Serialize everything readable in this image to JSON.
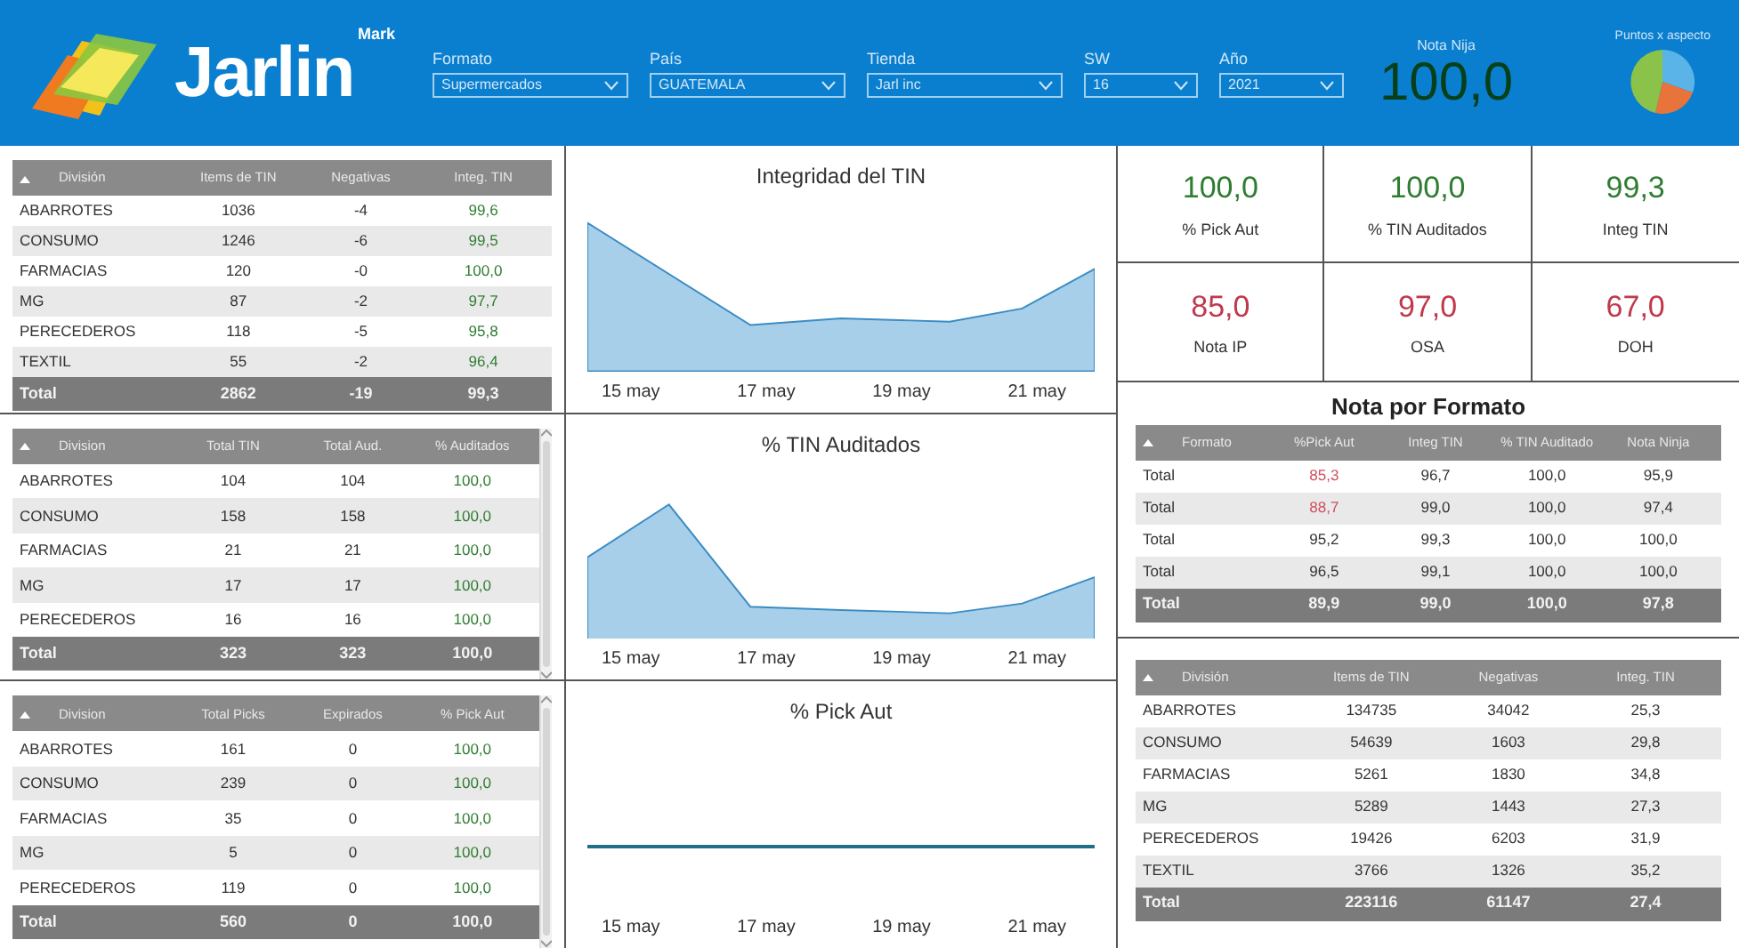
{
  "header": {
    "logo": {
      "word": "Jarlin",
      "badge": "Mark"
    },
    "filters": [
      {
        "label": "Formato",
        "value": "Supermercados"
      },
      {
        "label": "País",
        "value": "GUATEMALA"
      },
      {
        "label": "Tienda",
        "value": "Jarl inc"
      },
      {
        "label": "SW",
        "value": "16"
      },
      {
        "label": "Año",
        "value": "2021"
      }
    ],
    "score": {
      "label": "Nota Nija",
      "value": "100,0"
    },
    "pie": {
      "title": "Puntos x aspecto"
    }
  },
  "left_tables": [
    {
      "columns": [
        {
          "label": "División"
        },
        {
          "label": "Items de TIN"
        },
        {
          "label": "Negativas"
        },
        {
          "label": "Integ. TIN",
          "green": true
        }
      ],
      "rows": [
        [
          "ABARROTES",
          "1036",
          "-4",
          "99,6"
        ],
        [
          "CONSUMO",
          "1246",
          "-6",
          "99,5"
        ],
        [
          "FARMACIAS",
          "120",
          "-0",
          "100,0"
        ],
        [
          "MG",
          "87",
          "-2",
          "97,7"
        ],
        [
          "PERECEDEROS",
          "118",
          "-5",
          "95,8"
        ],
        [
          "TEXTIL",
          "55",
          "-2",
          "96,4"
        ]
      ],
      "total": [
        "Total",
        "2862",
        "-19",
        "99,3"
      ]
    },
    {
      "columns": [
        {
          "label": "Division"
        },
        {
          "label": "Total TIN"
        },
        {
          "label": "Total Aud."
        },
        {
          "label": "% Auditados",
          "green": true
        }
      ],
      "scrollbar": true,
      "rows": [
        [
          "ABARROTES",
          "104",
          "104",
          "100,0"
        ],
        [
          "CONSUMO",
          "158",
          "158",
          "100,0"
        ],
        [
          "FARMACIAS",
          "21",
          "21",
          "100,0"
        ],
        [
          "MG",
          "17",
          "17",
          "100,0"
        ],
        [
          "PERECEDEROS",
          "16",
          "16",
          "100,0"
        ]
      ],
      "total": [
        "Total",
        "323",
        "323",
        "100,0"
      ]
    },
    {
      "columns": [
        {
          "label": "Division"
        },
        {
          "label": "Total Picks"
        },
        {
          "label": "Expirados"
        },
        {
          "label": "% Pick Aut",
          "green": true
        }
      ],
      "scrollbar": true,
      "rows": [
        [
          "ABARROTES",
          "161",
          "0",
          "100,0"
        ],
        [
          "CONSUMO",
          "239",
          "0",
          "100,0"
        ],
        [
          "FARMACIAS",
          "35",
          "0",
          "100,0"
        ],
        [
          "MG",
          "5",
          "0",
          "100,0"
        ],
        [
          "PERECEDEROS",
          "119",
          "0",
          "100,0"
        ]
      ],
      "total": [
        "Total",
        "560",
        "0",
        "100,0"
      ]
    }
  ],
  "charts": [
    {
      "title": "Integridad del TIN",
      "kind": "area",
      "x_labels": [
        "15 may",
        "17 may",
        "19 may",
        "21 may"
      ]
    },
    {
      "title": "% TIN Auditados",
      "kind": "area",
      "x_labels": [
        "15 may",
        "17 may",
        "19 may",
        "21 may"
      ]
    },
    {
      "title": "% Pick Aut",
      "kind": "line",
      "x_labels": [
        "15 may",
        "17 may",
        "19 may",
        "21 may"
      ]
    }
  ],
  "kpis": [
    {
      "value": "100,0",
      "label": "% Pick Aut",
      "alert": false
    },
    {
      "value": "100,0",
      "label": "% TIN Auditados",
      "alert": false
    },
    {
      "value": "99,3",
      "label": "Integ TIN",
      "alert": false
    },
    {
      "value": "85,0",
      "label": "Nota IP",
      "alert": true
    },
    {
      "value": "97,0",
      "label": "OSA",
      "alert": true
    },
    {
      "value": "67,0",
      "label": "DOH",
      "alert": true
    }
  ],
  "format_table": {
    "title": "Nota por Formato",
    "columns": [
      {
        "label": "Formato"
      },
      {
        "label": "%Pick Aut"
      },
      {
        "label": "Integ TIN"
      },
      {
        "label": "% TIN Auditado"
      },
      {
        "label": "Nota Ninja"
      }
    ],
    "rows": [
      {
        "cells": [
          "Total",
          "85,3",
          "96,7",
          "100,0",
          "95,9"
        ],
        "low": [
          false,
          true,
          false,
          false,
          false
        ]
      },
      {
        "cells": [
          "Total",
          "88,7",
          "99,0",
          "100,0",
          "97,4"
        ],
        "low": [
          false,
          true,
          false,
          false,
          false
        ]
      },
      {
        "cells": [
          "Total",
          "95,2",
          "99,3",
          "100,0",
          "100,0"
        ],
        "low": [
          false,
          false,
          false,
          false,
          false
        ]
      },
      {
        "cells": [
          "Total",
          "96,5",
          "99,1",
          "100,0",
          "100,0"
        ],
        "low": [
          false,
          false,
          false,
          false,
          false
        ]
      }
    ],
    "total": [
      "Total",
      "89,9",
      "99,0",
      "100,0",
      "97,8"
    ]
  },
  "division_table": {
    "columns": [
      {
        "label": "División"
      },
      {
        "label": "Items de TIN"
      },
      {
        "label": "Negativas"
      },
      {
        "label": "Integ. TIN"
      }
    ],
    "rows": [
      [
        "ABARROTES",
        "134735",
        "34042",
        "25,3"
      ],
      [
        "CONSUMO",
        "54639",
        "1603",
        "29,8"
      ],
      [
        "FARMACIAS",
        "5261",
        "1830",
        "34,8"
      ],
      [
        "MG",
        "5289",
        "1443",
        "27,3"
      ],
      [
        "PERECEDEROS",
        "19426",
        "6203",
        "31,9"
      ],
      [
        "TEXTIL",
        "3766",
        "1326",
        "35,2"
      ]
    ],
    "total": [
      "Total",
      "223116",
      "61147",
      "27,4"
    ]
  }
}
